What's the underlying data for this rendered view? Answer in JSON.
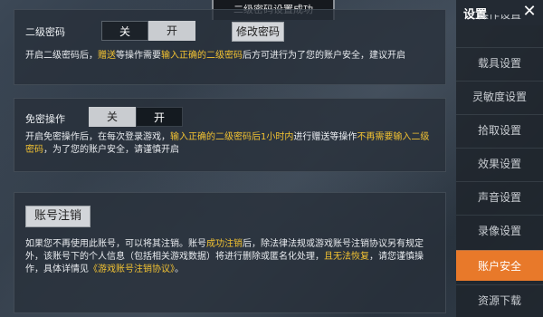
{
  "toast": "二级密码设置成功",
  "second_password": {
    "label": "二级密码",
    "off_label": "关",
    "on_label": "开",
    "change_button": "修改密码",
    "desc": [
      {
        "t": "开启二级密码后，",
        "hl": false
      },
      {
        "t": "赠送",
        "hl": true
      },
      {
        "t": "等操作需要",
        "hl": false
      },
      {
        "t": "输入正确的二级密码",
        "hl": true
      },
      {
        "t": "后方可进行为了您的账户安全，建议开启",
        "hl": false
      }
    ]
  },
  "no_password": {
    "label": "免密操作",
    "off_label": "关",
    "on_label": "开",
    "desc": [
      {
        "t": "开启免密操作后，在每次登录游戏，",
        "hl": false
      },
      {
        "t": "输入正确的二级密码后1小时内",
        "hl": true
      },
      {
        "t": "进行赠送等操作",
        "hl": false
      },
      {
        "t": "不再需要输入二级密码",
        "hl": true
      },
      {
        "t": "，为了您的账户安全，请谨慎开启",
        "hl": false
      }
    ]
  },
  "account_cancel": {
    "button": "账号注销",
    "desc": [
      {
        "t": "如果您不再使用此账号，可以将其注销。账号",
        "hl": false
      },
      {
        "t": "成功注销",
        "hl": true
      },
      {
        "t": "后，除法律法规或游戏账号注销协议另有规定外，该账号下的个人信息（包括相关游戏数据）将进行删除或匿名化处理，",
        "hl": false
      },
      {
        "t": "且无法恢复",
        "hl": true
      },
      {
        "t": "，请您谨慎操作，具体详情见",
        "hl": false
      },
      {
        "t": "《游戏账号注销协议》",
        "hl": true
      },
      {
        "t": "。",
        "hl": false
      }
    ]
  },
  "sidebar": {
    "title": "设置",
    "close_icon": "close-icon",
    "items": [
      "操作设置",
      "载具设置",
      "灵敏度设置",
      "拾取设置",
      "效果设置",
      "声音设置",
      "录像设置",
      "账户安全",
      "资源下载"
    ],
    "active_index": 7
  },
  "colors": {
    "highlight": "#f2c232",
    "active_tab": "#e8792a"
  }
}
